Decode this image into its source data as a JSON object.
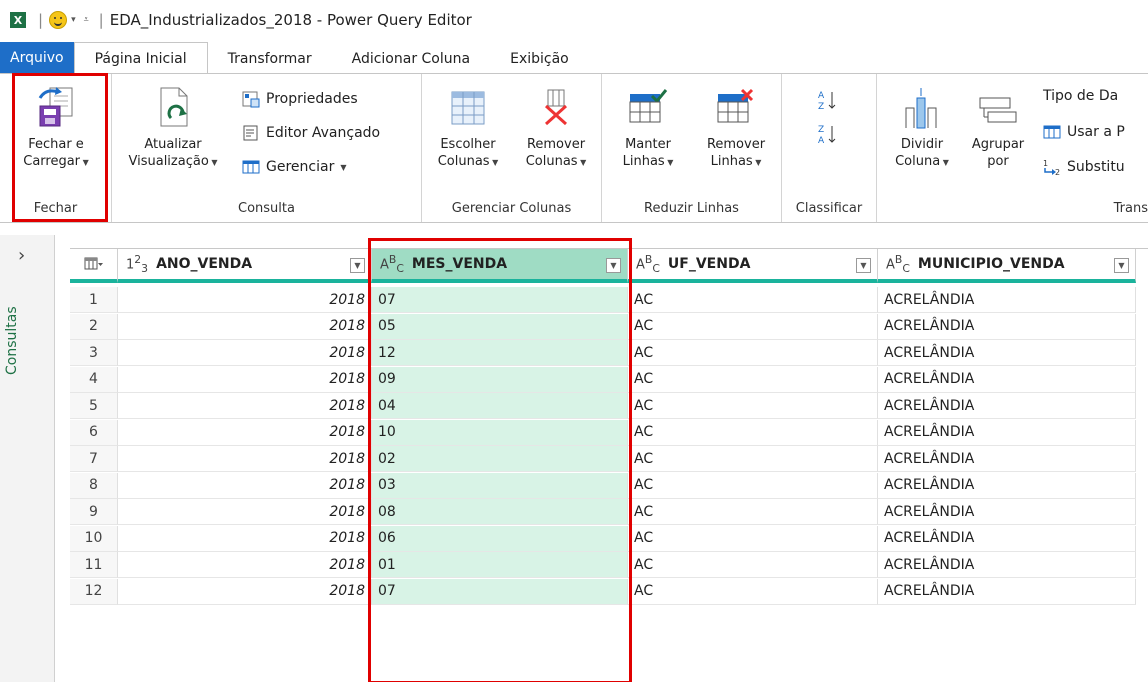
{
  "window": {
    "title": "EDA_Industrializados_2018 - Power Query Editor"
  },
  "tabs": [
    {
      "label": "Arquivo",
      "active": false
    },
    {
      "label": "Página Inicial",
      "active": true
    },
    {
      "label": "Transformar",
      "active": false
    },
    {
      "label": "Adicionar Coluna",
      "active": false
    },
    {
      "label": "Exibição",
      "active": false
    }
  ],
  "ribbon": {
    "fechar": {
      "group_label": "Fechar",
      "close_load_line1": "Fechar e",
      "close_load_line2": "Carregar"
    },
    "consulta": {
      "group_label": "Consulta",
      "refresh_line1": "Atualizar",
      "refresh_line2": "Visualização",
      "properties": "Propriedades",
      "advanced_editor": "Editor Avançado",
      "manage": "Gerenciar"
    },
    "gerenciar_colunas": {
      "group_label": "Gerenciar Colunas",
      "choose_line1": "Escolher",
      "choose_line2": "Colunas",
      "remove_line1": "Remover",
      "remove_line2": "Colunas"
    },
    "reduzir_linhas": {
      "group_label": "Reduzir Linhas",
      "keep_line1": "Manter",
      "keep_line2": "Linhas",
      "remove_line1": "Remover",
      "remove_line2": "Linhas"
    },
    "classificar": {
      "group_label": "Classificar"
    },
    "transformar": {
      "group_label": "Trans",
      "split_line1": "Dividir",
      "split_line2": "Coluna",
      "group_line1": "Agrupar",
      "group_line2": "por",
      "datatype": "Tipo de Da",
      "first_row": "Usar a P",
      "replace": "Substitu"
    }
  },
  "queries_pane": {
    "label": "Consultas"
  },
  "grid": {
    "columns": [
      {
        "type": "1²₃",
        "name": "ANO_VENDA"
      },
      {
        "type": "A^B_C",
        "name": "MES_VENDA"
      },
      {
        "type": "A^B_C",
        "name": "UF_VENDA"
      },
      {
        "type": "A^B_C",
        "name": "MUNICIPIO_VENDA"
      }
    ],
    "rows": [
      {
        "n": "1",
        "ano": "2018",
        "mes": "07",
        "uf": "AC",
        "mun": "ACRELÂNDIA"
      },
      {
        "n": "2",
        "ano": "2018",
        "mes": "05",
        "uf": "AC",
        "mun": "ACRELÂNDIA"
      },
      {
        "n": "3",
        "ano": "2018",
        "mes": "12",
        "uf": "AC",
        "mun": "ACRELÂNDIA"
      },
      {
        "n": "4",
        "ano": "2018",
        "mes": "09",
        "uf": "AC",
        "mun": "ACRELÂNDIA"
      },
      {
        "n": "5",
        "ano": "2018",
        "mes": "04",
        "uf": "AC",
        "mun": "ACRELÂNDIA"
      },
      {
        "n": "6",
        "ano": "2018",
        "mes": "10",
        "uf": "AC",
        "mun": "ACRELÂNDIA"
      },
      {
        "n": "7",
        "ano": "2018",
        "mes": "02",
        "uf": "AC",
        "mun": "ACRELÂNDIA"
      },
      {
        "n": "8",
        "ano": "2018",
        "mes": "03",
        "uf": "AC",
        "mun": "ACRELÂNDIA"
      },
      {
        "n": "9",
        "ano": "2018",
        "mes": "08",
        "uf": "AC",
        "mun": "ACRELÂNDIA"
      },
      {
        "n": "10",
        "ano": "2018",
        "mes": "06",
        "uf": "AC",
        "mun": "ACRELÂNDIA"
      },
      {
        "n": "11",
        "ano": "2018",
        "mes": "01",
        "uf": "AC",
        "mun": "ACRELÂNDIA"
      },
      {
        "n": "12",
        "ano": "2018",
        "mes": "07",
        "uf": "AC",
        "mun": "ACRELÂNDIA"
      }
    ]
  },
  "colors": {
    "accent": "#1ab39c",
    "selected_header": "#9fdcc4",
    "selected_cell": "#d8f3e6",
    "highlight_box": "#e00000",
    "file_tab": "#1e6ec8"
  }
}
